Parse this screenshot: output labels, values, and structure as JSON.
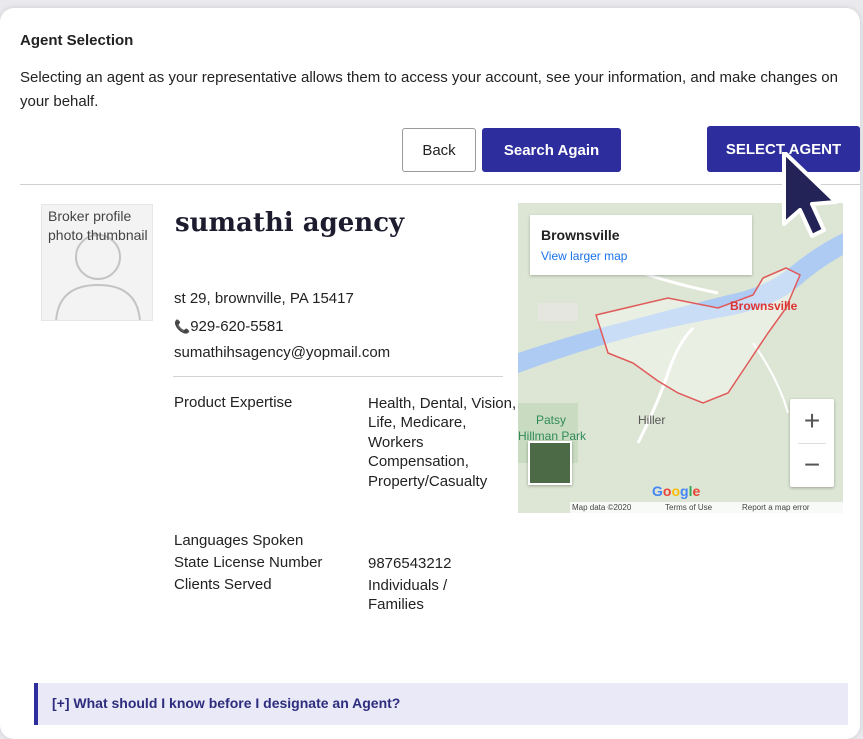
{
  "header": {
    "title": "Agent Selection",
    "description": "Selecting an agent as your representative allows them to access your account, see your information, and make changes on your behalf."
  },
  "buttons": {
    "back": "Back",
    "search_again": "Search Again",
    "select_agent": "SELECT AGENT"
  },
  "agent": {
    "photo_alt": "Broker profile photo thumbnail",
    "name": "sumathi agency",
    "address": "st 29, brownville, PA 15417",
    "phone": "929-620-5581",
    "email": "sumathihsagency@yopmail.com",
    "details": [
      {
        "label": "Product Expertise",
        "value": "Health, Dental, Vision, Life, Medicare, Workers Compensation, Property/Casualty"
      },
      {
        "label": "Languages Spoken",
        "value": ""
      },
      {
        "label": "State License Number",
        "value": "9876543212"
      },
      {
        "label": "Clients Served",
        "value": "Individuals / Families"
      }
    ]
  },
  "map": {
    "place": "Brownsville",
    "larger_map_link": "View larger map",
    "zoom_in": "+",
    "zoom_out": "−",
    "map_data": "Map data ©2020",
    "terms": "Terms of Use",
    "report": "Report a map error",
    "google": "Google",
    "labels": {
      "brownsville": "Brownsville",
      "patsy": "Patsy",
      "hillman_park": "Hillman Park",
      "hiller": "Hiller"
    },
    "colors": {
      "river": "#aecbf3",
      "boundary": "#e05a5a",
      "land": "#dde6d4"
    }
  },
  "faq": {
    "text": "[+] What should I know before I designate an Agent?"
  },
  "colors": {
    "primary": "#2d2d9e",
    "faq_bg": "#e9e9f7"
  }
}
